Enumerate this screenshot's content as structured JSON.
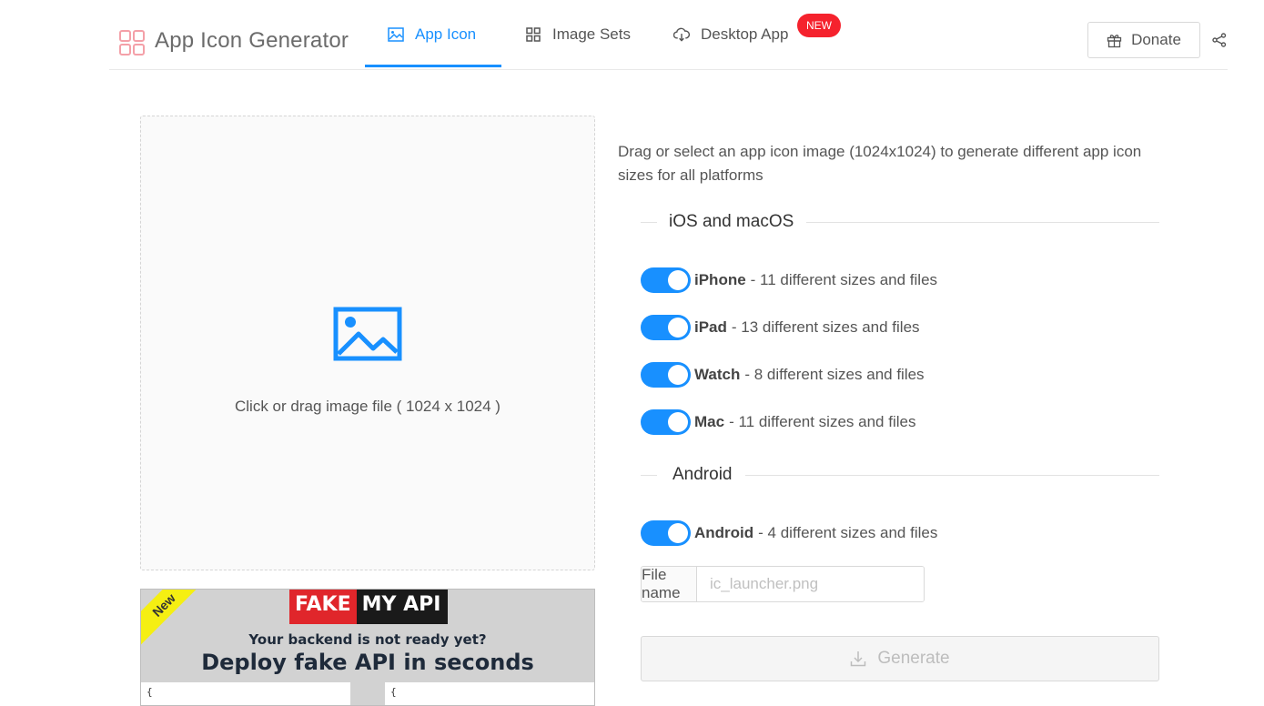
{
  "app": {
    "title": "App Icon Generator"
  },
  "nav": {
    "tabs": [
      {
        "label": "App Icon",
        "icon": "image-icon",
        "active": true
      },
      {
        "label": "Image Sets",
        "icon": "grid-icon",
        "active": false
      },
      {
        "label": "Desktop App",
        "icon": "cloud-download-icon",
        "active": false,
        "badge": "NEW"
      }
    ]
  },
  "header": {
    "donate_label": "Donate",
    "share_icon": "share-icon"
  },
  "upload": {
    "prompt": "Click or drag image file ( 1024 x 1024 )",
    "icon": "picture-icon"
  },
  "ad": {
    "ribbon": "New",
    "brand_left": "FAKE",
    "brand_right": "MY API",
    "subtitle": "Your backend is not ready yet?",
    "headline": "Deploy fake API in seconds",
    "code_left": "{",
    "code_right": "{"
  },
  "panel": {
    "description": "Drag or select an app icon image (1024x1024) to generate different app icon sizes for all platforms",
    "sections": [
      {
        "title": "iOS and macOS",
        "options": [
          {
            "name": "iPhone",
            "detail": "- 11 different sizes and files",
            "enabled": true
          },
          {
            "name": "iPad",
            "detail": "- 13 different sizes and files",
            "enabled": true
          },
          {
            "name": "Watch",
            "detail": "- 8 different sizes and files",
            "enabled": true
          },
          {
            "name": "Mac",
            "detail": "- 11 different sizes and files",
            "enabled": true
          }
        ]
      },
      {
        "title": "Android",
        "options": [
          {
            "name": "Android",
            "detail": "- 4 different sizes and files",
            "enabled": true
          }
        ]
      }
    ],
    "file_name_label": "File name",
    "file_name_placeholder": "ic_launcher.png",
    "generate_label": "Generate"
  },
  "colors": {
    "accent": "#1890ff",
    "badge": "#f5222d"
  }
}
